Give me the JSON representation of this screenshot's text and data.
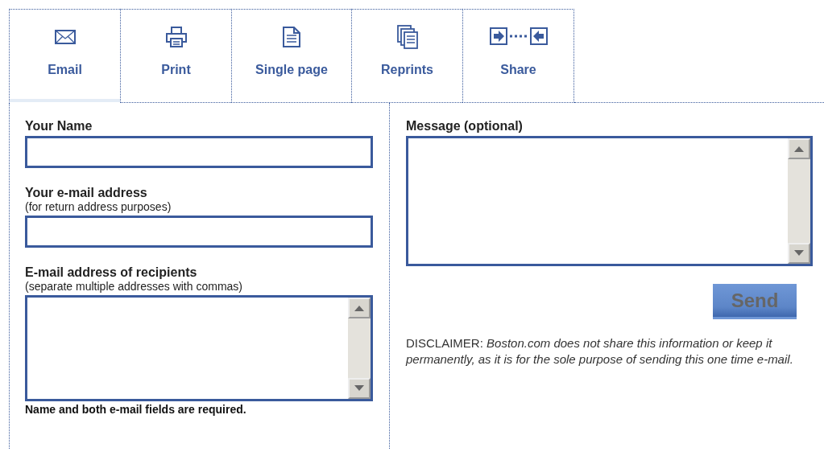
{
  "tabs": [
    {
      "label": "Email",
      "kind": "envelope",
      "selected": true
    },
    {
      "label": "Print",
      "kind": "printer",
      "selected": false
    },
    {
      "label": "Single page",
      "kind": "page",
      "selected": false
    },
    {
      "label": "Reprints",
      "kind": "pages",
      "selected": false
    },
    {
      "label": "Share",
      "kind": "share",
      "selected": false
    }
  ],
  "left_fields": [
    {
      "label": "Your Name",
      "kind": "input"
    },
    {
      "label": "Your e-mail address",
      "hint": "(for return address purposes)",
      "kind": "input"
    },
    {
      "label": "E-mail address of recipients",
      "hint": "(separate multiple addresses with commas)",
      "kind": "textarea"
    }
  ],
  "required_note": "Name and both e-mail fields are required.",
  "message": {
    "label": "Message (optional)"
  },
  "send_button": {
    "label": "Send",
    "disabled": true
  },
  "disclaimer": "DISCLAIMER: *Boston.com does not share this information or keep it permanently, as it is for the sole purpose of sending this one time e-mail.*"
}
